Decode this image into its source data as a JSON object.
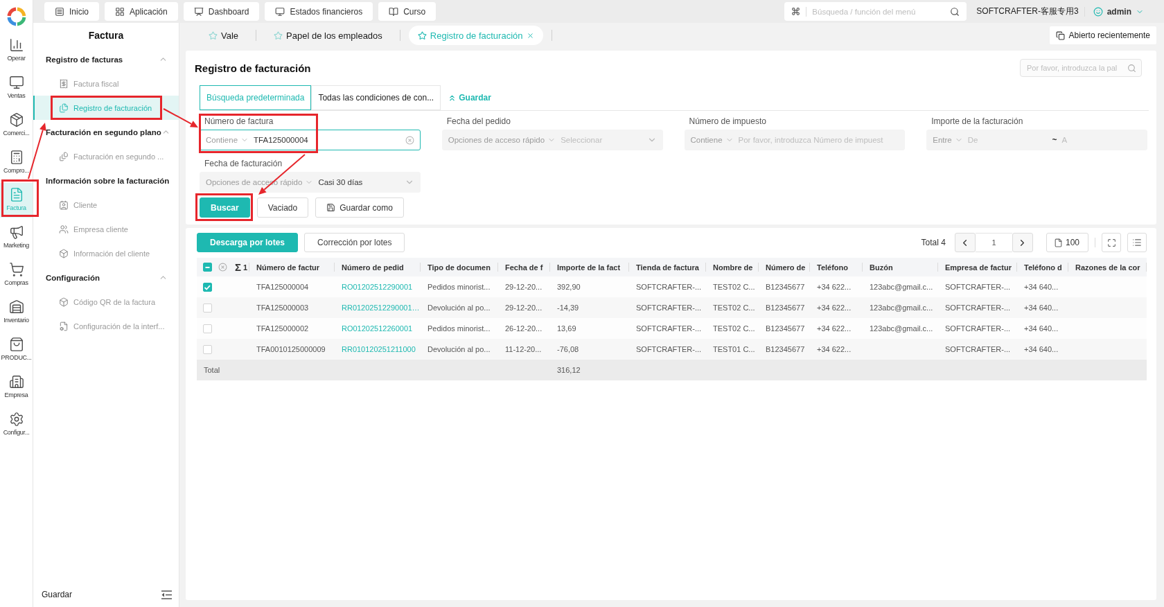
{
  "app_rail": {
    "items": [
      {
        "label": "Operar",
        "selected": false,
        "highlighted": false
      },
      {
        "label": "Ventas",
        "selected": false,
        "highlighted": false
      },
      {
        "label": "Comerci...",
        "selected": false,
        "highlighted": false
      },
      {
        "label": "Compro...",
        "selected": false,
        "highlighted": false
      },
      {
        "label": "Factura",
        "selected": true,
        "highlighted": true
      },
      {
        "label": "Marketing",
        "selected": false,
        "highlighted": false
      },
      {
        "label": "Compras",
        "selected": false,
        "highlighted": false
      },
      {
        "label": "Inventario",
        "selected": false,
        "highlighted": false
      },
      {
        "label": "PRODUC...",
        "selected": false,
        "highlighted": false
      },
      {
        "label": "Empresa",
        "selected": false,
        "highlighted": false
      },
      {
        "label": "Configur...",
        "selected": false,
        "highlighted": false
      }
    ]
  },
  "top_bar": {
    "nav": [
      "Inicio",
      "Aplicación",
      "Dashboard",
      "Estados financieros",
      "Curso"
    ],
    "menu_search": {
      "placeholder": "Búsqueda / función del menú"
    },
    "company": "SOFTCRAFTER-客服专用3",
    "user": "admin"
  },
  "sidebar": {
    "title": "Factura",
    "groups": [
      {
        "title": "Registro de facturas",
        "expanded": true,
        "items": [
          {
            "label": "Factura fiscal",
            "selected": false,
            "highlighted": false
          },
          {
            "label": "Registro de facturación",
            "selected": true,
            "highlighted": true
          }
        ]
      },
      {
        "title": "Facturación en segundo plano",
        "expanded": true,
        "items": [
          {
            "label": "Facturación en segundo ...",
            "selected": false,
            "highlighted": false
          }
        ]
      },
      {
        "title": "Información sobre la facturación",
        "items": [
          {
            "label": "Cliente",
            "selected": false,
            "highlighted": false
          },
          {
            "label": "Empresa cliente",
            "selected": false,
            "highlighted": false
          },
          {
            "label": "Información del cliente",
            "selected": false,
            "highlighted": false
          }
        ]
      },
      {
        "title": "Configuración",
        "expanded": true,
        "items": [
          {
            "label": "Código QR de la factura",
            "selected": false,
            "highlighted": false
          },
          {
            "label": "Configuración de la interf...",
            "selected": false,
            "highlighted": false
          }
        ]
      }
    ],
    "footer": "Guardar"
  },
  "page_tabs": {
    "tabs": [
      {
        "label": "Vale",
        "selected": false
      },
      {
        "label": "Papel de los empleados",
        "selected": false
      },
      {
        "label": "Registro de facturación",
        "selected": true
      }
    ],
    "recent_button": "Abierto recientemente"
  },
  "search_panel": {
    "title": "Registro de facturación",
    "keyword_search": {
      "placeholder": "Por favor, introduzca la pal"
    },
    "tabs": [
      {
        "label": "Búsqueda predeterminada",
        "selected": true
      },
      {
        "label": "Todas las condiciones de con...",
        "selected": false
      }
    ],
    "save_link": "Guardar",
    "fields": [
      {
        "label": "Número de factura",
        "kind": "text",
        "operator": "Contiene",
        "value": "TFA125000004",
        "focused": true,
        "highlighted": true
      },
      {
        "label": "Fecha del pedido",
        "kind": "date",
        "quick_option": "Opciones de acceso rápido",
        "placeholder": "Seleccionar",
        "focused": false,
        "highlighted": false
      },
      {
        "label": "Número de impuesto",
        "kind": "text",
        "operator": "Contiene",
        "placeholder": "Por favor, introduzca Número de impuest",
        "focused": false,
        "highlighted": false
      },
      {
        "label": "Importe de la facturación",
        "kind": "range",
        "operator": "Entre",
        "from_placeholder": "De",
        "separator": "~",
        "to_placeholder": "A",
        "focused": false,
        "highlighted": false
      },
      {
        "label": "Fecha de facturación",
        "kind": "date",
        "quick_option": "Opciones de acceso rápido",
        "value": "Casi 30 días",
        "focused": false,
        "highlighted": false
      }
    ],
    "buttons": [
      {
        "label": "Buscar",
        "kind": "primary",
        "highlighted": true
      },
      {
        "label": "Vaciado",
        "kind": "default",
        "highlighted": false
      },
      {
        "label": "Guardar como",
        "kind": "save",
        "highlighted": false
      }
    ]
  },
  "results": {
    "actions": [
      {
        "label": "Descarga por lotes",
        "kind": "primary"
      },
      {
        "label": "Corrección por lotes",
        "kind": "default"
      }
    ],
    "total": "Total 4",
    "page": "1",
    "page_size": "100",
    "table": {
      "select_all": {
        "indeterminate": true
      },
      "sum_symbol": "Σ",
      "selected_count": "1",
      "columns": [
        {
          "label": "Número de factur",
          "kind": "text"
        },
        {
          "label": "Número de pedid",
          "kind": "link"
        },
        {
          "label": "Tipo de documen",
          "kind": "text"
        },
        {
          "label": "Fecha de f",
          "kind": "text"
        },
        {
          "label": "Importe de la fact",
          "kind": "amount"
        },
        {
          "label": "Tienda de factura",
          "kind": "text"
        },
        {
          "label": "Nombre de",
          "kind": "text"
        },
        {
          "label": "Número de",
          "kind": "text"
        },
        {
          "label": "Teléfono",
          "kind": "text"
        },
        {
          "label": "Buzón",
          "kind": "text"
        },
        {
          "label": "Empresa de factur",
          "kind": "text"
        },
        {
          "label": "Teléfono d",
          "kind": "text"
        },
        {
          "label": "Razones de la cor",
          "kind": "text"
        }
      ],
      "rows": [
        {
          "selected": true,
          "cells": [
            "TFA125000004",
            "RO01202512290001",
            "Pedidos minorist...",
            "29-12-20...",
            "392,90",
            "SOFTCRAFTER-...",
            "TEST02 C...",
            "B12345677",
            "+34 622...",
            "123abc@gmail.c...",
            "SOFTCRAFTER-...",
            "+34 640..."
          ]
        },
        {
          "selected": false,
          "cells": [
            "TFA125000003",
            "RR01202512290001…",
            "Devolución al po...",
            "29-12-20...",
            "-14,39",
            "SOFTCRAFTER-...",
            "TEST02 C...",
            "B12345677",
            "+34 622...",
            "123abc@gmail.c...",
            "SOFTCRAFTER-...",
            "+34 640..."
          ]
        },
        {
          "selected": false,
          "cells": [
            "TFA125000002",
            "RO01202512260001",
            "Pedidos minorist...",
            "26-12-20...",
            "13,69",
            "SOFTCRAFTER-...",
            "TEST02 C...",
            "B12345677",
            "+34 622...",
            "123abc@gmail.c...",
            "SOFTCRAFTER-...",
            "+34 640..."
          ]
        },
        {
          "selected": false,
          "cells": [
            "TFA0010125000009",
            "RR010120251211000",
            "Devolución al po...",
            "11-12-20...",
            "-76,08",
            "SOFTCRAFTER-...",
            "TEST01 C...",
            "B12345677",
            "+34 622...",
            null,
            "SOFTCRAFTER-...",
            "+34 640..."
          ]
        }
      ],
      "total": {
        "label": "Total",
        "amount": "316,12"
      }
    }
  }
}
